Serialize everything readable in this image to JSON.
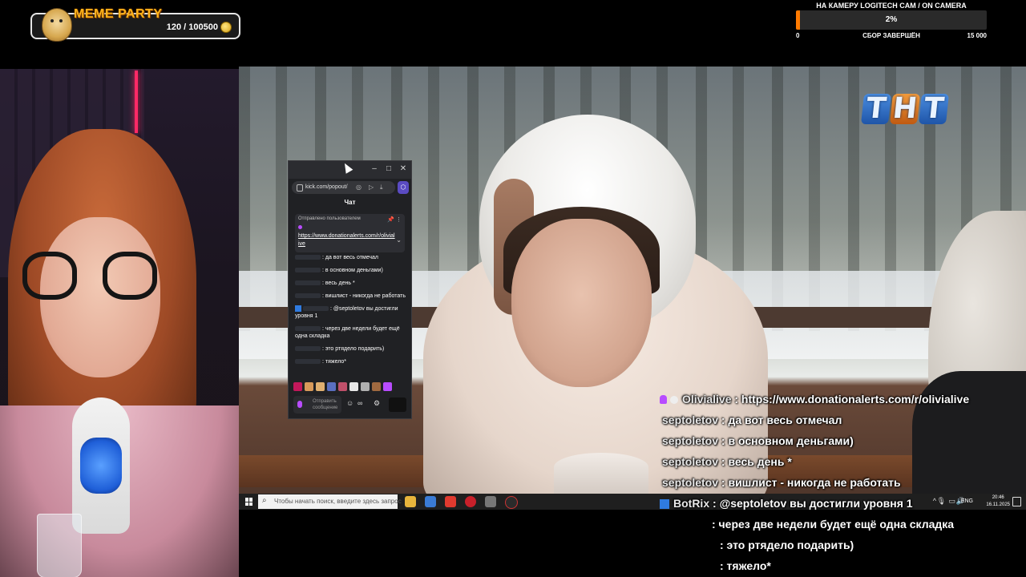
{
  "meme_party": {
    "title": "MEME PARTY",
    "count": "120 / 100500"
  },
  "goal": {
    "title": "НА КАМЕРУ LOGITECH CAM / ON CAMERA",
    "percent_label": "2%",
    "progress": 0.02,
    "min_label": "0",
    "status_label": "СБОР ЗАВЕРШЁН",
    "max_label": "15 000",
    "fill_color": "#ff7a00"
  },
  "tv_logo": [
    "Т",
    "Н",
    "Т"
  ],
  "popup": {
    "url": "kick.com/popout/",
    "chat_title": "Чат",
    "pinned_label": "Отправлено пользователем",
    "pinned_link": "https://www.donationalerts.com/r/olivialive",
    "messages": [
      ": да вот весь отмечал",
      ": в основном деньгами)",
      ": весь день *",
      ": вишлист - никогда не работать",
      ": @septoletov вы достигли уровня 1",
      ": через две недели будет ещё одна складка",
      ": это ртядело подарить)",
      ": тяжело*"
    ],
    "input_placeholder": "Отправить сообщение"
  },
  "taskbar": {
    "search_placeholder": "Чтобы начать поиск, введите здесь запрос",
    "lang": "ENG",
    "time": "20:46",
    "date": "16.11.2025"
  },
  "overlay_chat": [
    {
      "name": "Olivialive",
      "text": ": https://www.donationalerts.com/r/olivialive",
      "badge": "mic"
    },
    {
      "name": "septoletov",
      "text": ": да вот весь отмечал"
    },
    {
      "name": "septoletov",
      "text": ": в основном деньгами)"
    },
    {
      "name": "septoletov",
      "text": ": весь день *"
    },
    {
      "name": "septoletov",
      "text": ": вишлист - никогда не работать"
    },
    {
      "name": "BotRix",
      "text": ": @septoletov вы достигли уровня 1",
      "badge": "bot"
    },
    {
      "name": "",
      "text": ": через две недели будет ещё одна складка"
    },
    {
      "name": "",
      "text": ": это ртядело подарить)"
    },
    {
      "name": "",
      "text": ": тяжело*"
    }
  ],
  "colors": {
    "kick_purple": "#b84cff",
    "bot_blue": "#2f7be0",
    "meme_orange": "#ffb31a"
  }
}
